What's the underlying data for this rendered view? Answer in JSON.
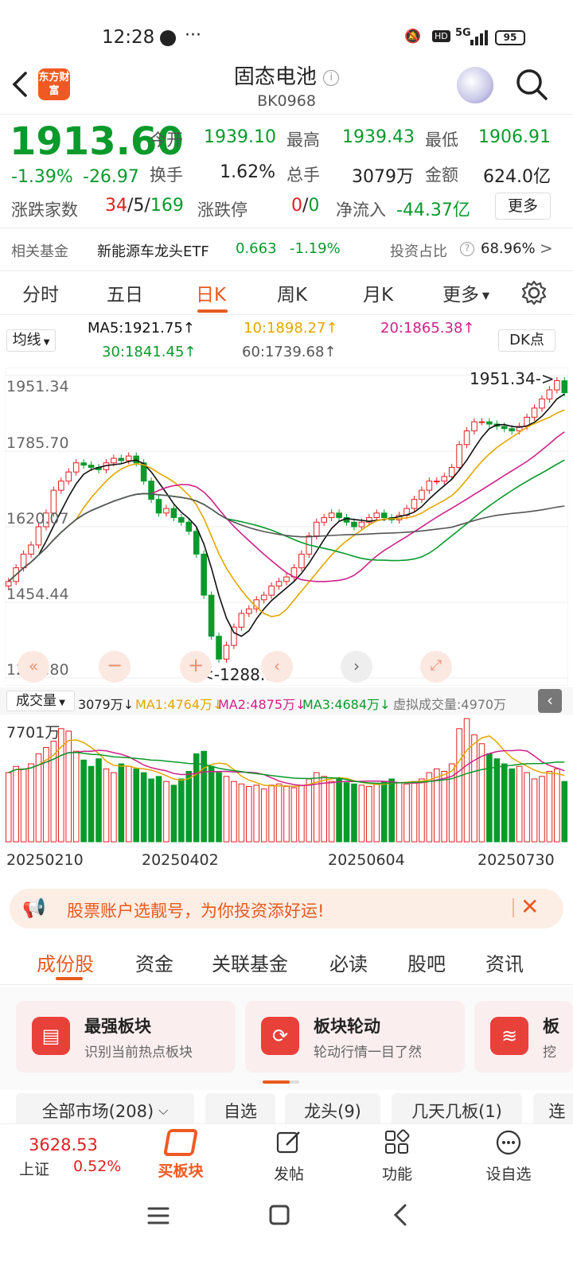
{
  "status": {
    "time": "12:28",
    "dots": "···",
    "net": "5G",
    "battery": "95"
  },
  "header": {
    "title": "固态电池",
    "code": "BK0968",
    "logo_text": "东方财富"
  },
  "quote": {
    "price": "1913.60",
    "change_pct": "-1.39%",
    "change": "-26.97",
    "open_label": "今开",
    "open": "1939.10",
    "high_label": "最高",
    "high": "1939.43",
    "low_label": "最低",
    "low": "1906.91",
    "turnover_label": "换手",
    "turnover": "1.62%",
    "volume_label": "总手",
    "volume": "3079万",
    "amount_label": "金额",
    "amount": "624.0亿",
    "counts_label": "涨跌家数",
    "up": "34",
    "flat": "5",
    "down": "169",
    "limit_label": "涨跌停",
    "limit_up": "0",
    "limit_down": "0",
    "netflow_label": "净流入",
    "netflow": "-44.37亿",
    "more_label": "更多"
  },
  "fund": {
    "label": "相关基金",
    "name": "新能源车龙头ETF",
    "price": "0.663",
    "pct": "-1.19%",
    "ratio_label": "投资占比",
    "ratio": "68.96%"
  },
  "tabs": [
    "分时",
    "五日",
    "日K",
    "周K",
    "月K",
    "更多"
  ],
  "ma": {
    "selector": "均线",
    "ma5": "MA5:1921.75↑",
    "ma10": "10:1898.27↑",
    "ma20": "20:1865.38↑",
    "ma30": "30:1841.45↑",
    "ma60": "60:1739.68↑",
    "dk": "DK点"
  },
  "chart_data": {
    "type": "candlestick",
    "y_ticks": [
      "1951.34",
      "1785.70",
      "1620.07",
      "1454.44",
      "1288.80"
    ],
    "ylim": [
      1288.8,
      1951.34
    ],
    "high_marker": "1951.34->",
    "low_marker": "<-1288.80",
    "closes": [
      1500,
      1530,
      1560,
      1580,
      1620,
      1650,
      1700,
      1720,
      1740,
      1760,
      1755,
      1750,
      1745,
      1760,
      1770,
      1765,
      1775,
      1760,
      1720,
      1680,
      1650,
      1660,
      1640,
      1630,
      1610,
      1560,
      1470,
      1380,
      1330,
      1360,
      1400,
      1430,
      1440,
      1460,
      1470,
      1490,
      1500,
      1510,
      1530,
      1560,
      1600,
      1630,
      1640,
      1650,
      1640,
      1630,
      1620,
      1630,
      1640,
      1650,
      1640,
      1635,
      1645,
      1660,
      1680,
      1700,
      1720,
      1720,
      1730,
      1750,
      1800,
      1830,
      1850,
      1850,
      1845,
      1840,
      1835,
      1830,
      1840,
      1860,
      1880,
      1900,
      1920,
      1940,
      1913.6
    ],
    "dates": [
      "20250210",
      "20250402",
      "20250604",
      "20250730"
    ]
  },
  "volume": {
    "selector": "成交量",
    "value": "3079万↓",
    "ma1": "MA1:4764万↓",
    "ma2": "MA2:4875万↓",
    "ma3": "MA3:4684万↓",
    "virtual": "虚拟成交量:4970万",
    "max": "7701万"
  },
  "volume_data": [
    55,
    60,
    58,
    62,
    70,
    75,
    80,
    90,
    88,
    72,
    65,
    60,
    66,
    58,
    55,
    62,
    60,
    58,
    55,
    50,
    52,
    48,
    45,
    50,
    56,
    70,
    72,
    60,
    55,
    52,
    48,
    46,
    44,
    45,
    42,
    45,
    46,
    44,
    43,
    45,
    50,
    55,
    52,
    48,
    50,
    47,
    46,
    45,
    44,
    46,
    48,
    50,
    47,
    46,
    48,
    50,
    55,
    58,
    56,
    62,
    90,
    98,
    85,
    78,
    70,
    66,
    62,
    58,
    60,
    55,
    50,
    52,
    56,
    58,
    48
  ],
  "promo": {
    "text": "股票账户选靓号，为你投资添好运!"
  },
  "subtabs": [
    "成份股",
    "资金",
    "关联基金",
    "必读",
    "股吧",
    "资讯"
  ],
  "cards": [
    {
      "title": "最强板块",
      "desc": "识别当前热点板块"
    },
    {
      "title": "板块轮动",
      "desc": "轮动行情一目了然"
    },
    {
      "title": "板",
      "desc": "挖"
    }
  ],
  "filters": [
    "全部市场(208)",
    "自选",
    "龙头(9)",
    "几天几板(1)",
    "连"
  ],
  "bottom": {
    "index_value": "3628.53",
    "index_name": "上证",
    "index_pct": "0.52%",
    "buy": "买板块",
    "post": "发帖",
    "func": "功能",
    "setfav": "设自选"
  }
}
